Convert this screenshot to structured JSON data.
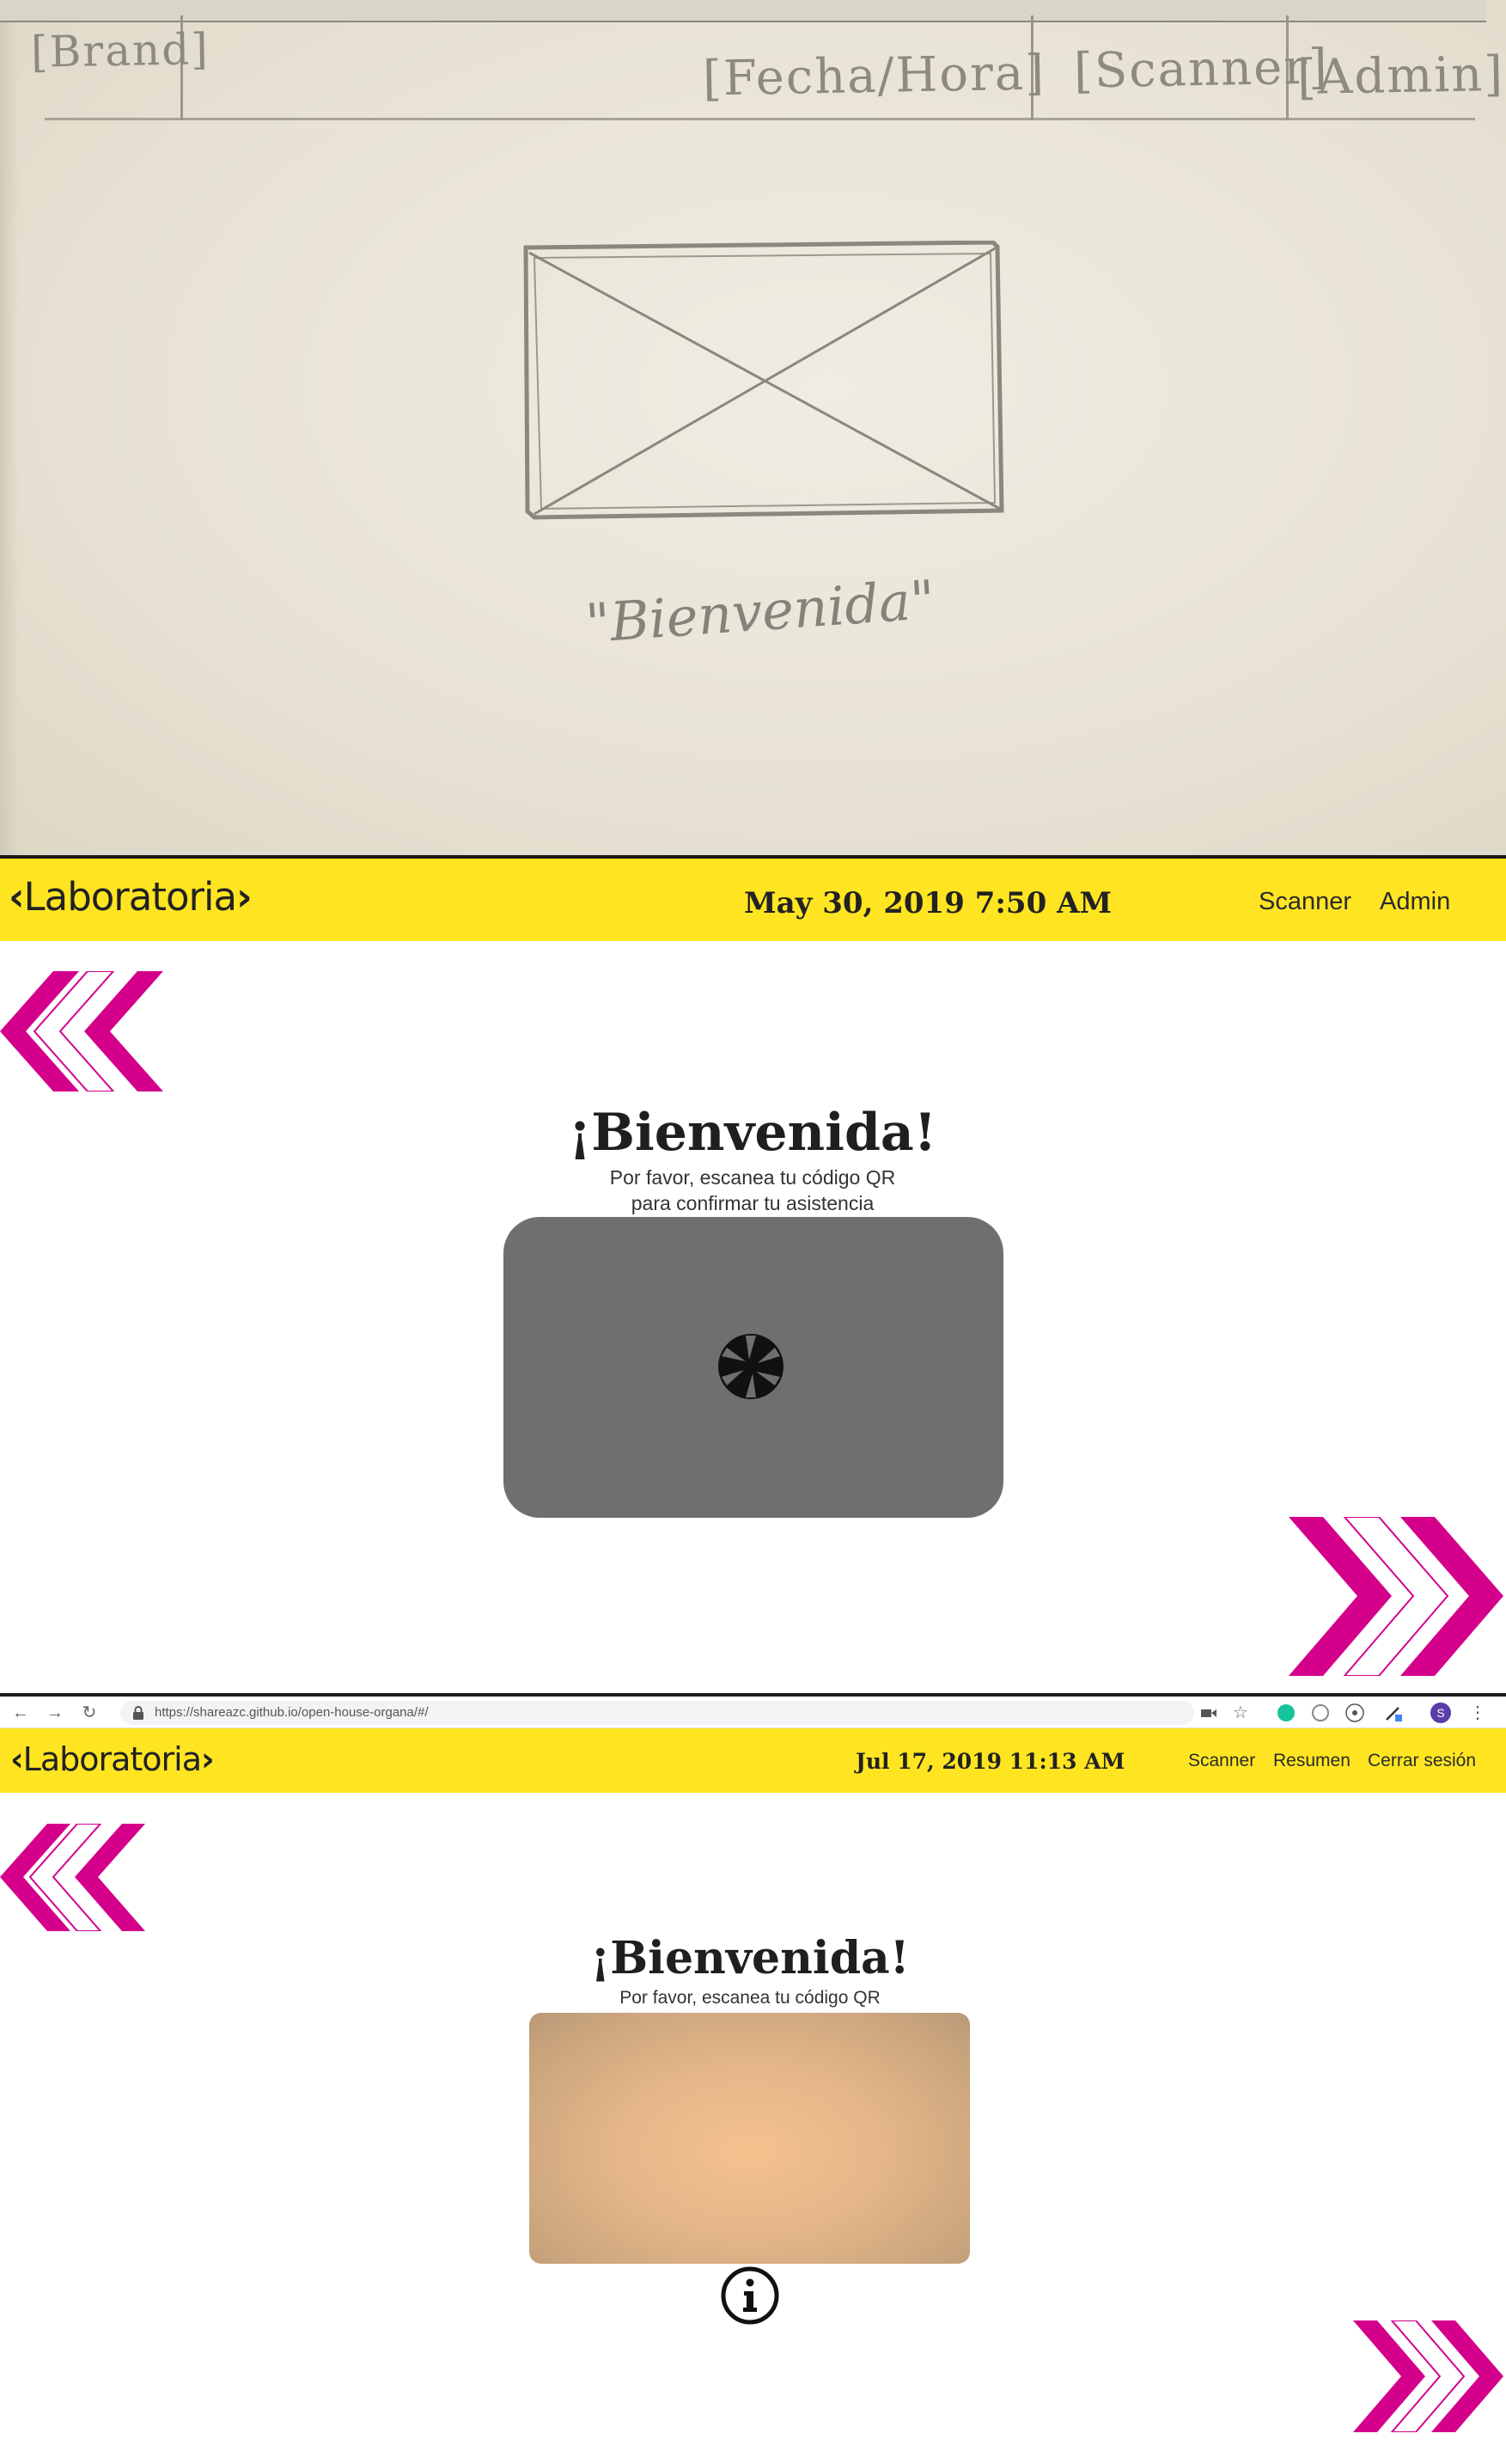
{
  "sketch": {
    "brand": "[Brand]",
    "datetime": "[Fecha/Hora]",
    "scanner": "[Scanner]",
    "admin": "[Admin]",
    "welcome": "\"Bienvenida\""
  },
  "mockup": {
    "brand": "Laboratoria",
    "datetime": "May 30, 2019 7:50 AM",
    "nav": {
      "scanner": "Scanner",
      "admin": "Admin"
    },
    "title": "¡Bienvenida!",
    "subtitle_line1": "Por favor, escanea tu código QR",
    "subtitle_line2": "para confirmar tu asistencia"
  },
  "browser": {
    "url": "https://shareazc.github.io/open-house-organa/#/",
    "avatar_letter": "S"
  },
  "app": {
    "brand": "Laboratoria",
    "datetime": "Jul 17, 2019 11:13 AM",
    "nav": {
      "scanner": "Scanner",
      "resumen": "Resumen",
      "logout": "Cerrar sesión"
    },
    "title": "¡Bienvenida!",
    "subtitle": "Por favor, escanea tu código QR"
  },
  "colors": {
    "navbar_yellow": "#ffe521",
    "accent_magenta": "#d4008c",
    "camera_placeholder_gray": "#6f6f6f"
  },
  "icons": [
    "chevron-left-icon",
    "chevron-right-icon",
    "camera-shutter-icon",
    "info-icon",
    "lock-icon",
    "back-icon",
    "forward-icon",
    "reload-icon",
    "star-icon",
    "camera-ext-icon"
  ]
}
